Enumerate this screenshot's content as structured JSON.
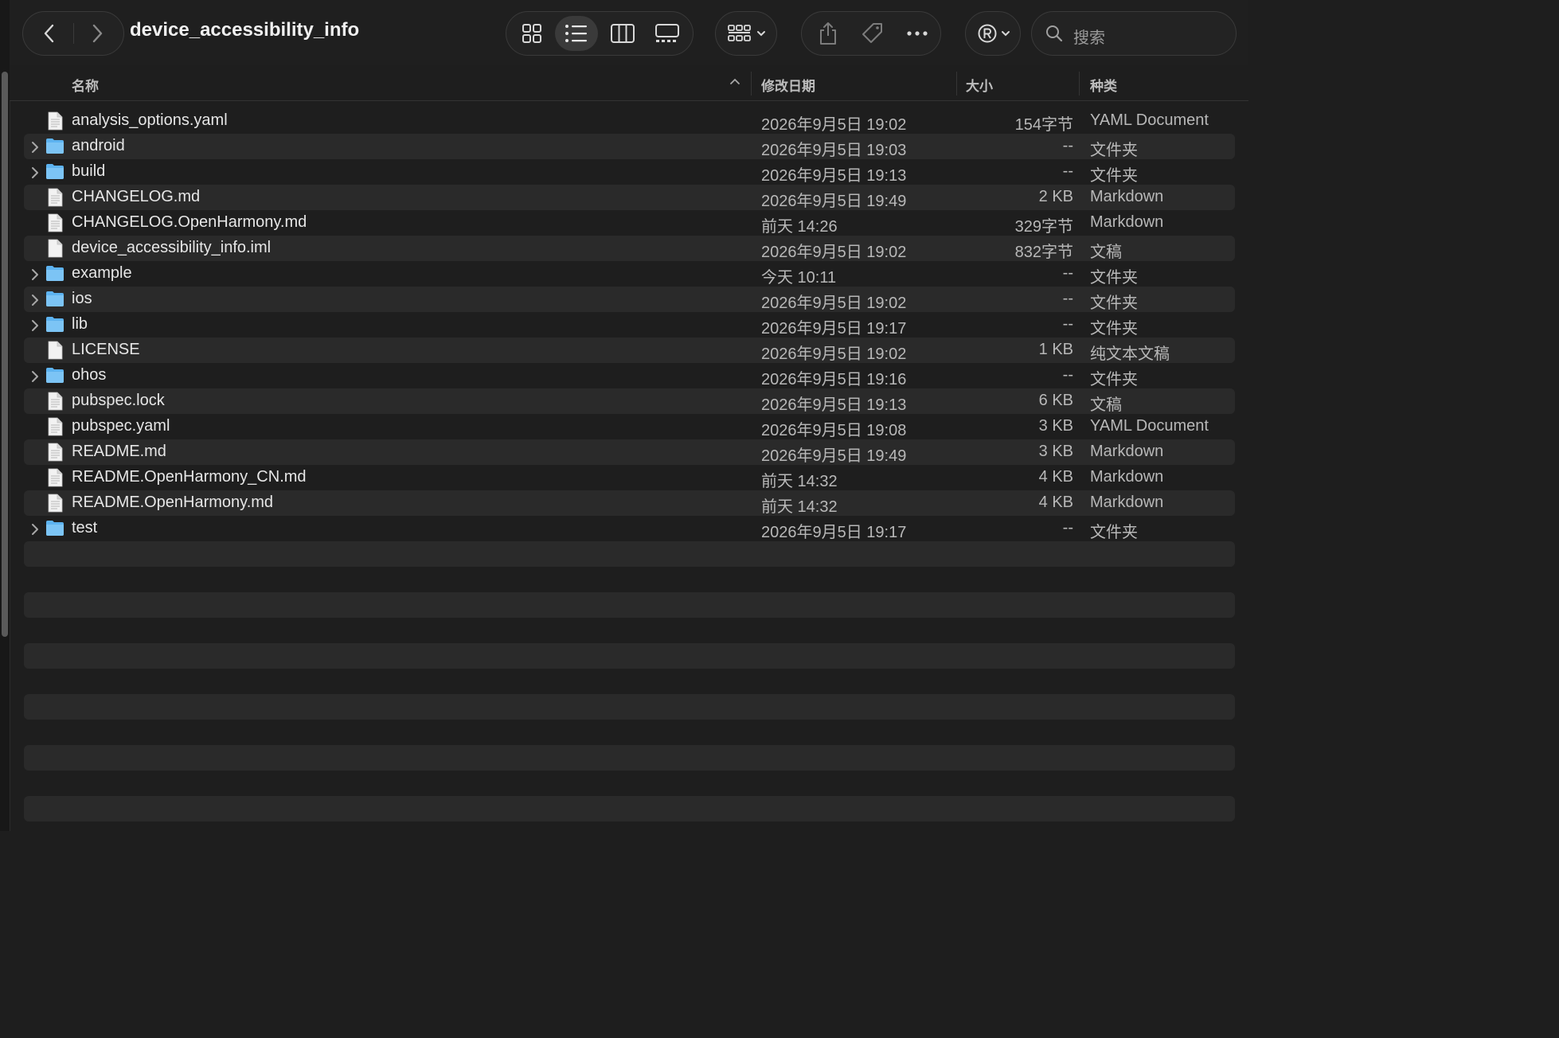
{
  "window": {
    "title": "device_accessibility_info"
  },
  "toolbar": {
    "back_icon": "chevron-left-icon",
    "forward_icon": "chevron-right-icon",
    "views": [
      "icon-view",
      "list-view",
      "column-view",
      "gallery-view"
    ],
    "selected_view": "list-view",
    "search_placeholder": "搜索"
  },
  "columns": {
    "name": "名称",
    "date": "修改日期",
    "size": "大小",
    "kind": "种类"
  },
  "files": [
    {
      "name": "analysis_options.yaml",
      "date": "2026年9月5日 19:02",
      "size": "154字节",
      "kind": "YAML Document",
      "type": "file"
    },
    {
      "name": "android",
      "date": "2026年9月5日 19:03",
      "size": "--",
      "kind": "文件夹",
      "type": "folder"
    },
    {
      "name": "build",
      "date": "2026年9月5日 19:13",
      "size": "--",
      "kind": "文件夹",
      "type": "folder"
    },
    {
      "name": "CHANGELOG.md",
      "date": "2026年9月5日 19:49",
      "size": "2 KB",
      "kind": "Markdown",
      "type": "file"
    },
    {
      "name": "CHANGELOG.OpenHarmony.md",
      "date": "前天 14:26",
      "size": "329字节",
      "kind": "Markdown",
      "type": "file"
    },
    {
      "name": "device_accessibility_info.iml",
      "date": "2026年9月5日 19:02",
      "size": "832字节",
      "kind": "文稿",
      "type": "blank"
    },
    {
      "name": "example",
      "date": "今天 10:11",
      "size": "--",
      "kind": "文件夹",
      "type": "folder"
    },
    {
      "name": "ios",
      "date": "2026年9月5日 19:02",
      "size": "--",
      "kind": "文件夹",
      "type": "folder"
    },
    {
      "name": "lib",
      "date": "2026年9月5日 19:17",
      "size": "--",
      "kind": "文件夹",
      "type": "folder"
    },
    {
      "name": "LICENSE",
      "date": "2026年9月5日 19:02",
      "size": "1 KB",
      "kind": "纯文本文稿",
      "type": "blank"
    },
    {
      "name": "ohos",
      "date": "2026年9月5日 19:16",
      "size": "--",
      "kind": "文件夹",
      "type": "folder"
    },
    {
      "name": "pubspec.lock",
      "date": "2026年9月5日 19:13",
      "size": "6 KB",
      "kind": "文稿",
      "type": "file"
    },
    {
      "name": "pubspec.yaml",
      "date": "2026年9月5日 19:08",
      "size": "3 KB",
      "kind": "YAML Document",
      "type": "file"
    },
    {
      "name": "README.md",
      "date": "2026年9月5日 19:49",
      "size": "3 KB",
      "kind": "Markdown",
      "type": "file"
    },
    {
      "name": "README.OpenHarmony_CN.md",
      "date": "前天 14:32",
      "size": "4 KB",
      "kind": "Markdown",
      "type": "file"
    },
    {
      "name": "README.OpenHarmony.md",
      "date": "前天 14:32",
      "size": "4 KB",
      "kind": "Markdown",
      "type": "file"
    },
    {
      "name": "test",
      "date": "2026年9月5日 19:17",
      "size": "--",
      "kind": "文件夹",
      "type": "folder"
    }
  ],
  "colors": {
    "folder": "#5db3f0",
    "background": "#1e1e1e",
    "stripe": "#2a2a2a"
  }
}
